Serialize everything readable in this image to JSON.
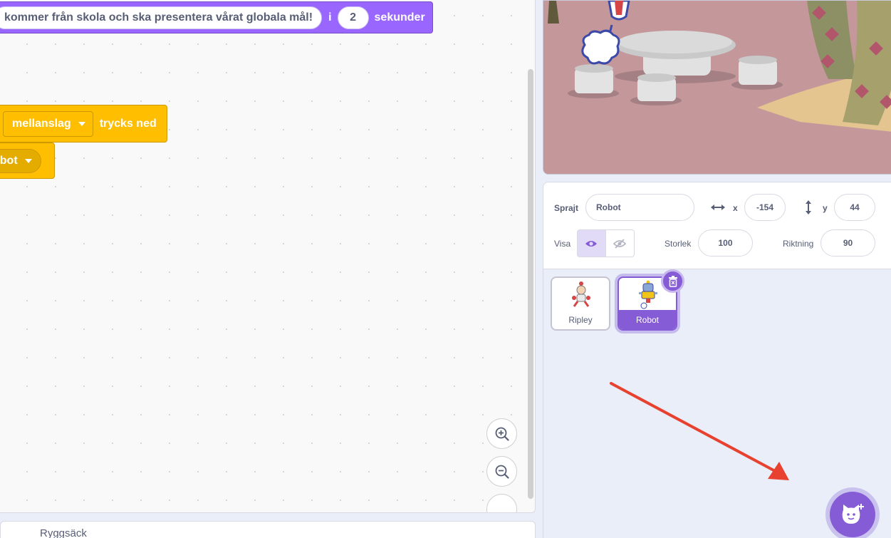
{
  "workspace": {
    "looks_block": {
      "message": "kommer från skola och ska presentera vårat globala mål!",
      "in_label": "i",
      "seconds_value": "2",
      "seconds_label": "sekunder"
    },
    "event_block": {
      "key": "mellanslag",
      "suffix": "trycks ned"
    },
    "control_block": {
      "target": "obot"
    }
  },
  "backpack": {
    "label": "Ryggsäck"
  },
  "sprite_info": {
    "sprite_label": "Sprajt",
    "sprite_name": "Robot",
    "x_label": "x",
    "x_value": "-154",
    "y_label": "y",
    "y_value": "44",
    "show_label": "Visa",
    "size_label": "Storlek",
    "size_value": "100",
    "direction_label": "Riktning",
    "direction_value": "90"
  },
  "sprites": [
    {
      "name": "Ripley",
      "selected": false
    },
    {
      "name": "Robot",
      "selected": true
    }
  ],
  "colors": {
    "accent": "#855cd6",
    "looks": "#9966ff",
    "events": "#ffbf00",
    "arrow": "#e8412f"
  },
  "icons": [
    "zoom-in-icon",
    "zoom-out-icon",
    "zoom-reset-icon",
    "eye-icon",
    "eye-slash-icon",
    "trash-icon",
    "x-arrows-icon",
    "y-arrows-icon",
    "add-sprite-cat-icon"
  ]
}
